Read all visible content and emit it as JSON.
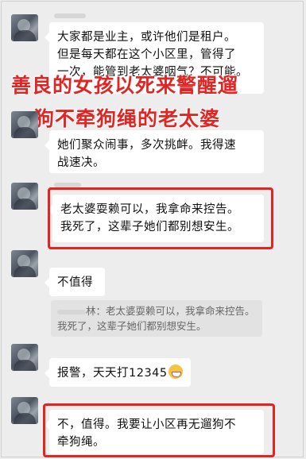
{
  "messages": [
    {
      "text": "大家都是业主，或许他们是租户。\n但是每天都在这个小区里，管得了\n一次，能管到老太婆咽气？不可能。"
    },
    {
      "text": "她们聚众闹事，多次挑衅。我得速\n战速决。"
    },
    {
      "text": "老太婆耍赖可以，我拿命来控告。\n我死了，这辈子她们都别想安生。"
    },
    {
      "text": "不值得"
    },
    {
      "text": "报警，天天打12345"
    },
    {
      "text": "不，值得。我要让小区再无遛狗不\n牵狗绳。"
    }
  ],
  "quote": {
    "sender_suffix": "林：",
    "text": "老太婆耍赖可以，我拿命来控告。我死了，这辈子她们都别想安生。"
  },
  "overlay_caption": {
    "line1": "善良的女孩以死来警醒遛",
    "line2": "狗不牵狗绳的老太婆"
  },
  "colors": {
    "highlight": "#e8231e",
    "caption": "#e02523",
    "background": "#ededed",
    "bubble": "#ffffff"
  }
}
